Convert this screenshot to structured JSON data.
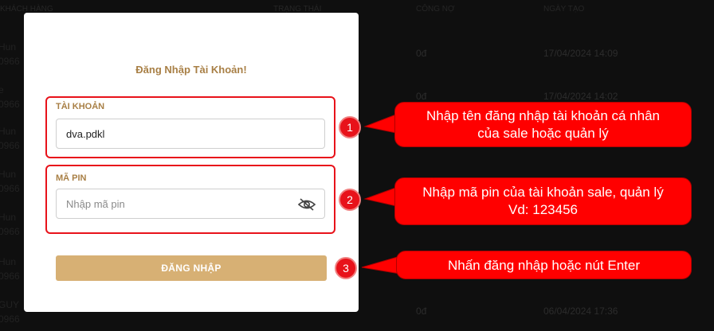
{
  "background": {
    "headers": [
      "KHÁCH HÀNG",
      "TRẠNG THÁI",
      "CÔNG NỢ",
      "NGÀY TẠO"
    ],
    "rows": [
      {
        "name": "Hun",
        "code": "0966",
        "debt": "0đ",
        "date": "17/04/2024 14:09"
      },
      {
        "name": "e",
        "code": "0966",
        "debt": "0đ",
        "date": "17/04/2024 14:02"
      },
      {
        "name": "Hun",
        "code": "0966",
        "debt": "",
        "date": ""
      },
      {
        "name": "Hun",
        "code": "0966",
        "debt": "",
        "date": ""
      },
      {
        "name": "Hun",
        "code": "0966",
        "debt": "",
        "date": ""
      },
      {
        "name": "Hun",
        "code": "0966",
        "debt": "",
        "date": ""
      },
      {
        "name": "GUY",
        "code": "0966",
        "debt": "0đ",
        "date": "06/04/2024 17:36"
      }
    ]
  },
  "modal": {
    "title": "Đăng Nhập Tài Khoản!",
    "account_label": "TÀI KHOẢN",
    "account_value": "dva.pdkl",
    "pin_label": "MÃ PIN",
    "pin_placeholder": "Nhập mã pin",
    "login_button": "ĐĂNG NHẬP"
  },
  "annotations": {
    "badges": [
      "1",
      "2",
      "3"
    ],
    "callout1_line1": "Nhập tên đăng nhập tài khoản cá nhân",
    "callout1_line2": "của sale hoặc quản lý",
    "callout2_line1": "Nhập mã pin của tài khoản sale, quản lý",
    "callout2_line2": "Vd: 123456",
    "callout3": "Nhấn đăng nhập hoặc nút Enter",
    "highlight_color": "#e8121a",
    "callout_color": "#ff0000"
  }
}
